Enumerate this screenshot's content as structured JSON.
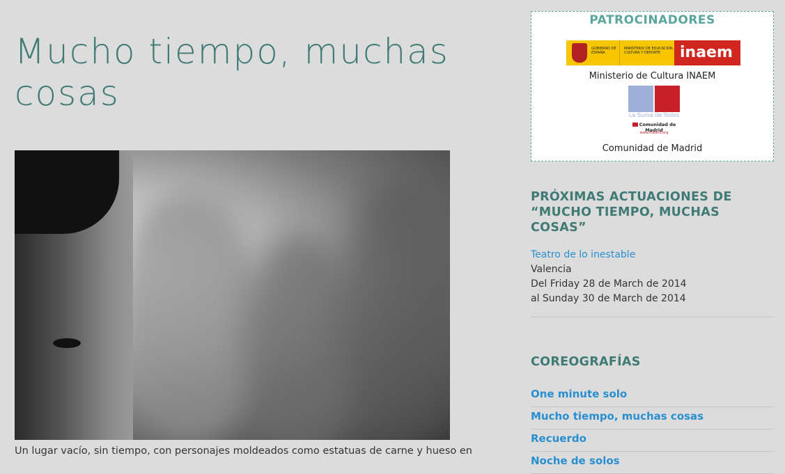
{
  "post": {
    "title": "Mucho tiempo, muchas cosas",
    "excerpt": "Un lugar vacío, sin tiempo, con personajes moldeados como estatuas de carne y hueso en"
  },
  "sponsors": {
    "title": "PATROCINADORES",
    "logo1": {
      "gobierno_text": "GOBIERNO DE ESPAÑA",
      "ministerio_text": "MINISTERIO DE EDUCACIÓN, CULTURA Y DEPORTE",
      "brand": "inaem",
      "caption": "Ministerio de Cultura INAEM"
    },
    "logo2": {
      "tagline": "La Suma de Todos",
      "name": "Comunidad de Madrid",
      "web": "www.madrid.org",
      "caption": "Comunidad de Madrid"
    }
  },
  "upcoming": {
    "title": "PRÓXIMAS ACTUACIONES DE “MUCHO TIEMPO, MUCHAS COSAS”",
    "event": {
      "venue": "Teatro de lo inestable",
      "city": "Valencia",
      "from": "Del Friday 28 de March de 2014",
      "to": "al Sunday 30 de March de 2014"
    }
  },
  "choreographies": {
    "title": "COREOGRAFÍAS",
    "items": [
      "One minute solo",
      "Mucho tiempo, muchas cosas",
      "Recuerdo",
      "Noche de solos"
    ]
  },
  "colors": {
    "background": "#dcdcdc",
    "title": "#3f7a74",
    "accent": "#5aa59c",
    "link": "#2a8fd0"
  }
}
